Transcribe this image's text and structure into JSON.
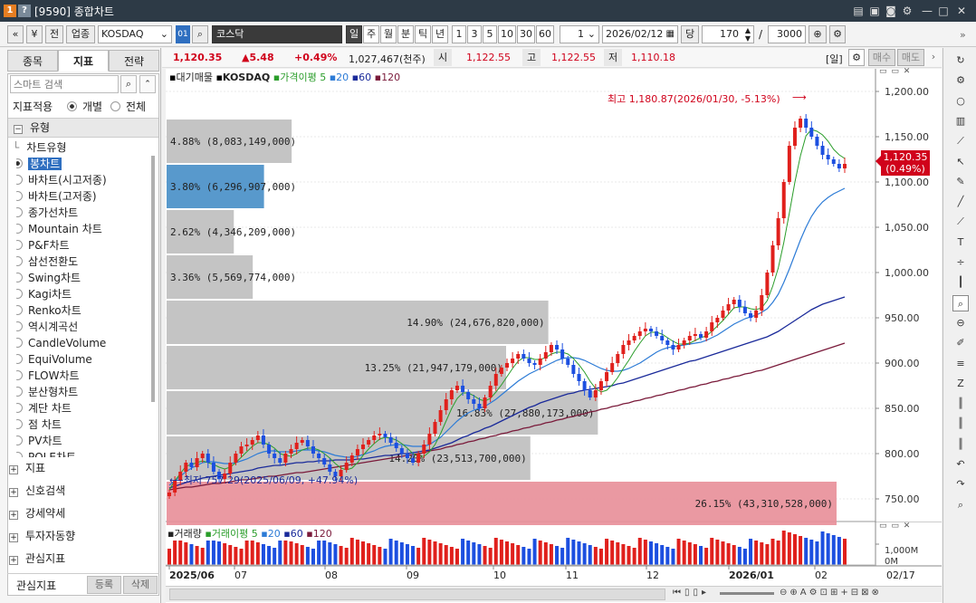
{
  "window": {
    "title_code": "[9590]",
    "title": "종합차트",
    "badge1": "1",
    "badge2": "?"
  },
  "toolbar": {
    "prev": "«",
    "drop": "»",
    "jeon": "전",
    "upjong": "업종",
    "symbol": "KOSDAQ",
    "code_btn": "01",
    "name": "코스닥",
    "periods": [
      "일",
      "주",
      "월",
      "분",
      "틱",
      "년"
    ],
    "nums": [
      "1",
      "3",
      "5",
      "10",
      "30",
      "60"
    ],
    "count_val": "1",
    "date": "2026/02/12",
    "dang": "당",
    "qty": "170",
    "slash": "/",
    "total": "3000"
  },
  "left": {
    "tabs": [
      "종목",
      "지표",
      "전략"
    ],
    "search_placeholder": "스마트 검색",
    "apply_label": "지표적용",
    "opt1": "개별",
    "opt2": "전체",
    "type_group": "유형",
    "chart_type_header": "차트유형",
    "chart_types": [
      "봉차트",
      "바차트(시고저종)",
      "바차트(고저종)",
      "종가선차트",
      "Mountain 차트",
      "P&F차트",
      "삼선전환도",
      "Swing차트",
      "Kagi차트",
      "Renko차트",
      "역시계곡선",
      "CandleVolume",
      "EquiVolume",
      "FLOW차트",
      "분산형차트",
      "계단 차트",
      "점 차트",
      "PV차트",
      "POLE차트"
    ],
    "sections": [
      "지표",
      "신호검색",
      "강세약세",
      "투자자동향",
      "관심지표"
    ],
    "bottom_label": "관심지표",
    "reg_btn": "등록",
    "del_btn": "삭제"
  },
  "info": {
    "price": "1,120.35",
    "change": "▲5.48",
    "pct": "+0.49%",
    "volume": "1,027,467(천주)",
    "open_label": "시",
    "open": "1,122.55",
    "high_label": "고",
    "high": "1,122.55",
    "low_label": "저",
    "low": "1,110.18",
    "period_tag": "[일]",
    "buy": "매수",
    "sell": "매도"
  },
  "legend": {
    "a": "대기매물",
    "b": "KOSDAQ",
    "c": "가격이평",
    "c5": "5",
    "c20": "20",
    "c60": "60",
    "c120": "120"
  },
  "vol_legend": {
    "a": "거래량",
    "b": "거래이평",
    "c5": "5",
    "c20": "20",
    "c60": "60",
    "c120": "120"
  },
  "annotations": {
    "max": "최고 1,180.87(2026/01/30, -5.13%)",
    "min": "최저 757.29(2025/06/09, +47.94%)",
    "cur_price": "1,120.35",
    "cur_pct": "(0.49%)"
  },
  "yaxis": [
    "1,200.00",
    "1,150.00",
    "1,100.00",
    "1,050.00",
    "1,000.00",
    "950.00",
    "900.00",
    "850.00",
    "800.00",
    "750.00"
  ],
  "vol_axis": "1,000M",
  "vol_axis2": "0M",
  "xaxis": [
    "2025/06",
    "07",
    "08",
    "09",
    "10",
    "11",
    "12",
    "2026/01",
    "02"
  ],
  "xaxis_end": "02/17",
  "chart_data": {
    "type": "candlestick",
    "price_range": [
      730,
      1215
    ],
    "supply_bars": [
      {
        "price_low": 1120,
        "price_high": 1170,
        "pct": "4.88%",
        "vol": "(8,083,149,000)",
        "value": 8083149000,
        "color": "#bfbfbf"
      },
      {
        "price_low": 1070,
        "price_high": 1120,
        "pct": "3.80%",
        "vol": "(6,296,907,000)",
        "value": 6296907000,
        "color": "#4a90c8"
      },
      {
        "price_low": 1020,
        "price_high": 1070,
        "pct": "2.62%",
        "vol": "(4,346,209,000)",
        "value": 4346209000,
        "color": "#bfbfbf"
      },
      {
        "price_low": 970,
        "price_high": 1020,
        "pct": "3.36%",
        "vol": "(5,569,774,000)",
        "value": 5569774000,
        "color": "#bfbfbf"
      },
      {
        "price_low": 920,
        "price_high": 970,
        "pct": "14.90%",
        "vol": "(24,676,820,000)",
        "value": 24676820000,
        "color": "#bfbfbf"
      },
      {
        "price_low": 870,
        "price_high": 920,
        "pct": "13.25%",
        "vol": "(21,947,179,000)",
        "value": 21947179000,
        "color": "#bfbfbf"
      },
      {
        "price_low": 820,
        "price_high": 870,
        "pct": "16.83%",
        "vol": "(27,880,173,000)",
        "value": 27880173000,
        "color": "#bfbfbf"
      },
      {
        "price_low": 770,
        "price_high": 820,
        "pct": "14.20%",
        "vol": "(23,513,700,000)",
        "value": 23513700000,
        "color": "#bfbfbf"
      },
      {
        "price_low": 720,
        "price_high": 770,
        "pct": "26.15%",
        "vol": "(43,310,528,000)",
        "value": 43310528000,
        "color": "#e8909a"
      }
    ],
    "closes": [
      757,
      770,
      780,
      790,
      785,
      795,
      800,
      790,
      780,
      772,
      778,
      790,
      800,
      808,
      810,
      815,
      820,
      810,
      800,
      795,
      790,
      800,
      805,
      812,
      815,
      808,
      800,
      795,
      788,
      780,
      775,
      782,
      790,
      798,
      805,
      810,
      815,
      820,
      822,
      818,
      812,
      806,
      800,
      795,
      790,
      800,
      810,
      822,
      835,
      848,
      860,
      870,
      875,
      868,
      860,
      855,
      850,
      862,
      875,
      888,
      895,
      900,
      905,
      910,
      905,
      900,
      898,
      905,
      912,
      920,
      915,
      905,
      898,
      888,
      880,
      870,
      862,
      870,
      880,
      890,
      900,
      910,
      920,
      925,
      930,
      935,
      938,
      935,
      930,
      925,
      920,
      915,
      920,
      925,
      930,
      932,
      928,
      935,
      945,
      950,
      958,
      965,
      970,
      962,
      955,
      950,
      958,
      975,
      1000,
      1030,
      1060,
      1100,
      1140,
      1160,
      1170,
      1160,
      1150,
      1140,
      1130,
      1125,
      1120,
      1115,
      1120
    ],
    "ma5": [
      760,
      770,
      778,
      786,
      788,
      790,
      792,
      790,
      788,
      785,
      783,
      785,
      790,
      796,
      802,
      808,
      812,
      812,
      810,
      806,
      800,
      798,
      797,
      800,
      804,
      806,
      806,
      804,
      800,
      795,
      789,
      784,
      782,
      784,
      790,
      798,
      805,
      811,
      816,
      818,
      817,
      815,
      811,
      806,
      800,
      797,
      797,
      802,
      810,
      822,
      836,
      850,
      861,
      867,
      867,
      864,
      860,
      858,
      861,
      868,
      876,
      885,
      894,
      902,
      906,
      906,
      904,
      904,
      906,
      910,
      912,
      912,
      910,
      905,
      898,
      890,
      880,
      872,
      868,
      870,
      876,
      884,
      894,
      903,
      913,
      922,
      930,
      934,
      934,
      932,
      928,
      924,
      921,
      921,
      922,
      925,
      928,
      930,
      935,
      941,
      947,
      954,
      961,
      962,
      962,
      960,
      959,
      961,
      969,
      985,
      1005,
      1033,
      1066,
      1100,
      1129,
      1151,
      1158,
      1156,
      1152,
      1145,
      1136,
      1130,
      1126
    ],
    "ma20": [
      765,
      770,
      775,
      780,
      784,
      787,
      790,
      791,
      791,
      790,
      789,
      789,
      790,
      792,
      794,
      797,
      800,
      802,
      803,
      803,
      802,
      802,
      802,
      803,
      804,
      804,
      804,
      803,
      802,
      800,
      798,
      797,
      796,
      796,
      797,
      799,
      801,
      803,
      806,
      808,
      809,
      810,
      810,
      809,
      808,
      808,
      808,
      810,
      814,
      818,
      824,
      830,
      836,
      841,
      845,
      848,
      850,
      852,
      856,
      860,
      865,
      870,
      875,
      880,
      884,
      888,
      891,
      894,
      897,
      900,
      903,
      905,
      906,
      906,
      905,
      903,
      900,
      897,
      894,
      892,
      891,
      891,
      892,
      894,
      897,
      900,
      904,
      908,
      912,
      915,
      917,
      918,
      919,
      920,
      921,
      922,
      923,
      925,
      928,
      931,
      935,
      939,
      943,
      946,
      949,
      951,
      953,
      956,
      960,
      967,
      976,
      989,
      1004,
      1020,
      1036,
      1050,
      1062,
      1071,
      1078,
      1083,
      1087,
      1090,
      1093
    ],
    "ma60": [
      762,
      764,
      766,
      768,
      770,
      771,
      773,
      774,
      775,
      776,
      777,
      778,
      779,
      780,
      781,
      782,
      784,
      785,
      786,
      787,
      787,
      788,
      789,
      790,
      790,
      791,
      791,
      792,
      792,
      792,
      793,
      793,
      793,
      793,
      794,
      794,
      795,
      796,
      797,
      798,
      798,
      799,
      800,
      800,
      801,
      802,
      803,
      804,
      806,
      808,
      810,
      812,
      815,
      818,
      820,
      823,
      825,
      828,
      830,
      833,
      836,
      839,
      842,
      845,
      848,
      851,
      853,
      856,
      858,
      860,
      862,
      864,
      866,
      867,
      869,
      870,
      871,
      872,
      873,
      874,
      875,
      877,
      878,
      880,
      882,
      884,
      886,
      888,
      890,
      892,
      894,
      896,
      898,
      900,
      902,
      903,
      905,
      907,
      909,
      911,
      913,
      915,
      917,
      919,
      921,
      923,
      925,
      927,
      929,
      932,
      935,
      939,
      943,
      947,
      951,
      955,
      959,
      962,
      965,
      967,
      969,
      971,
      973
    ],
    "ma120": [
      760,
      761,
      762,
      763,
      763,
      764,
      765,
      766,
      767,
      767,
      768,
      769,
      770,
      771,
      771,
      772,
      773,
      774,
      775,
      775,
      776,
      777,
      778,
      779,
      779,
      780,
      781,
      782,
      783,
      784,
      785,
      786,
      787,
      788,
      789,
      790,
      791,
      792,
      793,
      794,
      795,
      796,
      797,
      798,
      799,
      800,
      801,
      803,
      804,
      805,
      807,
      808,
      810,
      811,
      813,
      814,
      816,
      817,
      819,
      820,
      822,
      823,
      825,
      826,
      828,
      829,
      831,
      832,
      834,
      835,
      837,
      838,
      840,
      841,
      843,
      844,
      846,
      847,
      849,
      850,
      852,
      853,
      855,
      856,
      858,
      859,
      861,
      862,
      864,
      865,
      867,
      868,
      870,
      871,
      873,
      874,
      876,
      877,
      879,
      880,
      882,
      883,
      885,
      886,
      888,
      889,
      891,
      892,
      894,
      896,
      898,
      900,
      902,
      904,
      906,
      908,
      910,
      912,
      914,
      916,
      918,
      920,
      922
    ],
    "volume_scale_note": "relative"
  }
}
